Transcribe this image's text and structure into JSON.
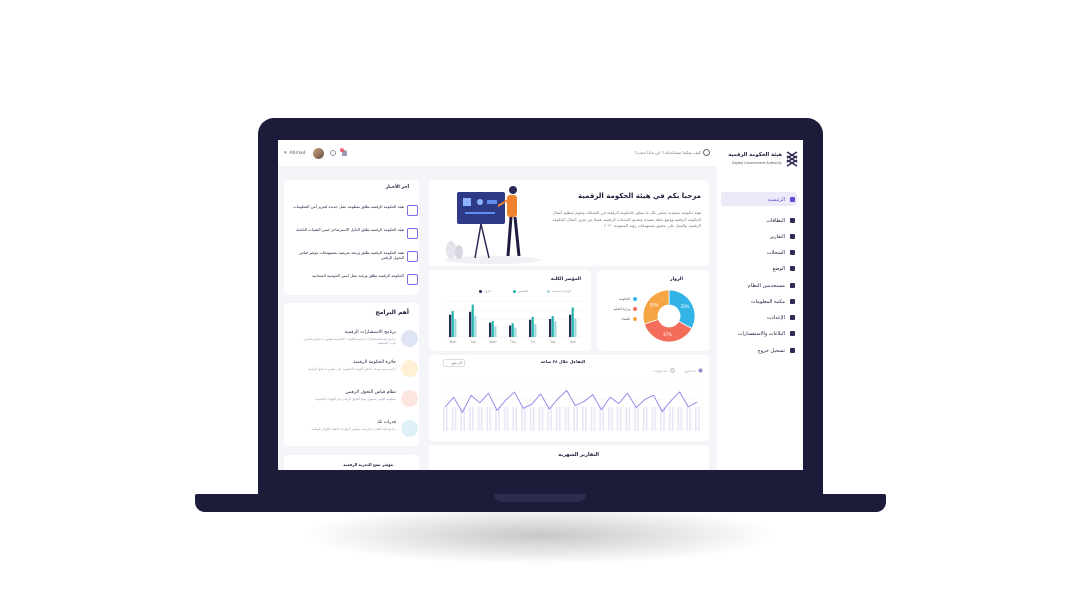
{
  "header": {
    "search_placeholder": "كيف يمكننا مساعدتك؟ عن ماذا تبحث؟",
    "user_name": "Ahmad",
    "notification_count": "2"
  },
  "brand": {
    "name_ar": "هيئة الحكومة الرقمية",
    "name_en": "Digital Government Authority"
  },
  "sidebar": {
    "items": [
      {
        "label": "الرئيسية",
        "icon": "home-icon",
        "active": true
      },
      {
        "label": "البطاقات",
        "icon": "cards-icon"
      },
      {
        "label": "التقارير",
        "icon": "reports-icon"
      },
      {
        "label": "السجلات",
        "icon": "records-icon"
      },
      {
        "label": "الوضع",
        "icon": "status-icon"
      },
      {
        "label": "مستخدمين النظام",
        "icon": "users-icon"
      },
      {
        "label": "مكتبة المعلومات",
        "icon": "library-icon"
      },
      {
        "label": "الإعدادت",
        "icon": "settings-icon"
      },
      {
        "label": "البلاغات والاستفسارات",
        "icon": "chat-icon"
      },
      {
        "label": "تسجيل خروج",
        "icon": "logout-icon"
      }
    ]
  },
  "welcome": {
    "title": "مرحبا بكم في هيئة الحكومة الرقمية",
    "body": "هيئة حكومية سعودية تختص بكل ما يتعلق بالحكومة الرقمية في المملكة، وتقوم بتنظيم أعمال الحكومة الرقمية ووضع خطة تنفيذية وتقديم الخدمات الرقمية، فضلا عن تعزيز أعمال الحكومة الرقمية، والعمل على تحقيق مستهدفات رؤية السعودية ٢٠٣٠"
  },
  "news": {
    "title": "آخر الأخبار",
    "items": [
      "هيئة الحكومة الرقمية تطلق منظومة عمل جديدة لتعزيز أمن المعلومات",
      "هيئة الحكومة الرقمية تطلق الدليل الاسترشادي لتبني التقنيات الناشئة",
      "هيئة الحكومة الرقمية تطلق ورشة تعريفية بمستهدفات مؤشر قياس التحول الرقمي",
      "الحكومة الرقمية تطلق ورشة عمل لتبني الحوسبة السحابية"
    ]
  },
  "programs": {
    "title": "أهم البرامج",
    "items": [
      {
        "title": "برنامج الاستشارات الرقمية",
        "desc": "برنامج يقدم الاستشارات الرقمية للجهات الحكومية لتطوير خدماتها وتحسين تجربة المستفيد"
      },
      {
        "title": "جائزة الحكومة الرقمية",
        "desc": "جائزة سنوية تهدف لتحفيز الجهات الحكومية على تطوير خدماتها الرقمية"
      },
      {
        "title": "نظام قياس التحول الرقمي",
        "desc": "منظومة لقياس مستوى نضج التحول الرقمي في الجهات الحكومية"
      },
      {
        "title": "قدرات تك",
        "desc": "برنامج لبناء القدرات الرقمية وتطوير المهارات التقنية للكوادر الوطنية"
      }
    ]
  },
  "indicator": {
    "title": "مؤشر نضج التجربة الرقمية"
  },
  "visitors": {
    "title": "الزوار",
    "legend": [
      "الحكومة",
      "وزارة التعليم",
      "القضاء"
    ],
    "colors": [
      "#32b4e6",
      "#f46d5a",
      "#f6a545"
    ],
    "values": [
      33,
      37,
      30
    ],
    "labels": [
      "33%",
      "37%",
      "30%"
    ]
  },
  "total_chart": {
    "title": "المؤشر الكلية",
    "legend": [
      "الزوار",
      "المتابعين",
      "الزيارات الجديدة"
    ],
    "colors": [
      "#2b2a55",
      "#22b5a9",
      "#9fd8df"
    ],
    "categories": [
      "Mon",
      "Tue",
      "Wed",
      "Thu",
      "Fri",
      "Sat",
      "Sun"
    ],
    "series": [
      {
        "name": "الزوار",
        "values": [
          62,
          70,
          40,
          32,
          48,
          50,
          62
        ]
      },
      {
        "name": "المتابعين",
        "values": [
          72,
          90,
          44,
          38,
          56,
          58,
          82
        ]
      },
      {
        "name": "الزيارات الجديدة",
        "values": [
          50,
          58,
          30,
          26,
          36,
          44,
          52
        ]
      }
    ]
  },
  "line_chart": {
    "title": "التفاعل خلال ٢٤ ساعة",
    "filter_label": "آخر شهر",
    "legend": [
      "عدد الزوار",
      "عدد الزيارات"
    ],
    "colors": [
      "#8b83e8",
      "#e8e6f7"
    ],
    "points": [
      38,
      52,
      30,
      55,
      44,
      58,
      33,
      48,
      60,
      36,
      42,
      57,
      35,
      50,
      62,
      40,
      46,
      56,
      34,
      52,
      43,
      58,
      37,
      49,
      55,
      31,
      47,
      60,
      38,
      45
    ]
  },
  "monthly": {
    "title": "التقارير الشهرية"
  }
}
